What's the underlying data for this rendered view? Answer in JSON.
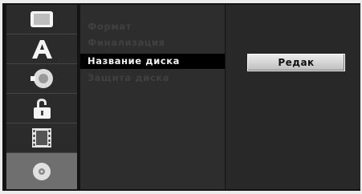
{
  "menu": {
    "items": [
      {
        "label": "Формат"
      },
      {
        "label": "Финализация"
      },
      {
        "label": "Название диска"
      },
      {
        "label": "Защита диска"
      }
    ]
  },
  "side_icons": [
    "tv-screen-icon",
    "language-letter-a-icon",
    "speaker-audio-icon",
    "padlock-icon",
    "film-reel-icon",
    "disc-icon"
  ],
  "action": {
    "button_label": "Редак"
  }
}
